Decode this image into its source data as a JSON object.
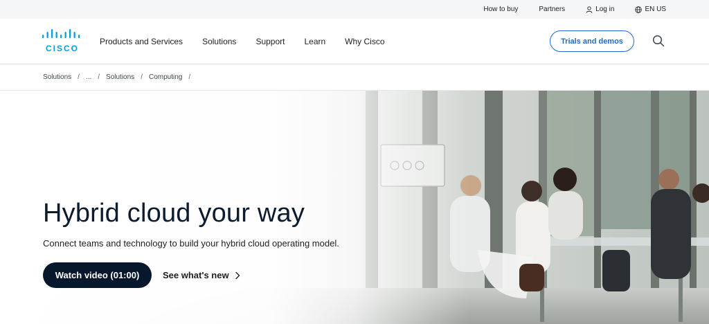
{
  "utility": {
    "how_to_buy": "How to buy",
    "partners": "Partners",
    "login": "Log in",
    "language": "EN US"
  },
  "brand": {
    "name": "CISCO",
    "color": "#049fd9"
  },
  "nav": {
    "items": [
      {
        "label": "Products and Services"
      },
      {
        "label": "Solutions"
      },
      {
        "label": "Support"
      },
      {
        "label": "Learn"
      },
      {
        "label": "Why Cisco"
      }
    ],
    "cta_label": "Trials and demos",
    "search_icon": "search-icon"
  },
  "breadcrumb": {
    "items": [
      "Solutions",
      "...",
      "Solutions",
      "Computing"
    ],
    "separator": "/"
  },
  "hero": {
    "title": "Hybrid cloud your way",
    "subtitle": "Connect teams and technology to build your hybrid cloud operating model.",
    "primary_button": "Watch video (01:00)",
    "secondary_link": "See what's new"
  },
  "colors": {
    "accent": "#1d69cc",
    "dark_button": "#07182d",
    "title_text": "#0d1b2e"
  }
}
